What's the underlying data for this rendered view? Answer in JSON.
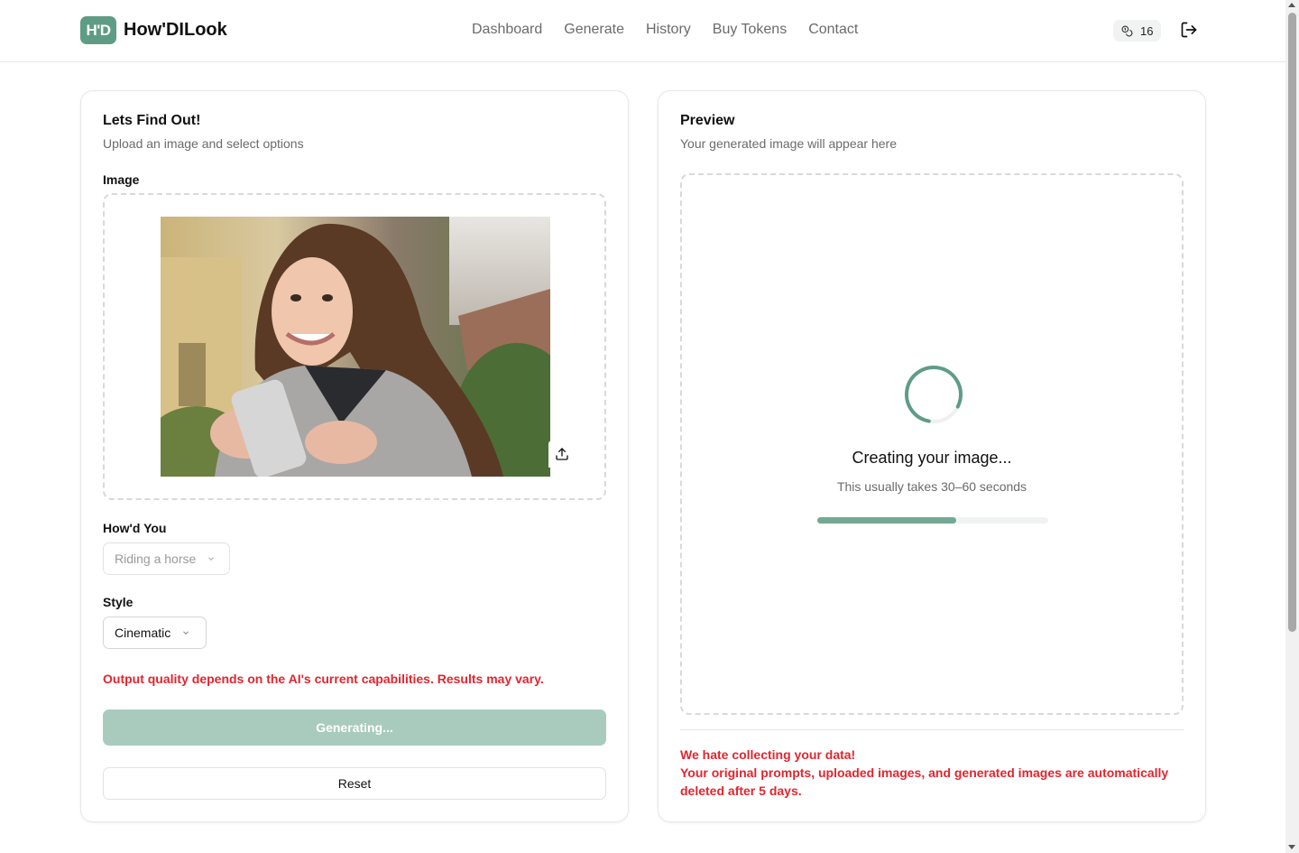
{
  "app": {
    "logo_badge": "H'D",
    "name": "How'DILook"
  },
  "nav": {
    "items": [
      {
        "label": "Dashboard"
      },
      {
        "label": "Generate"
      },
      {
        "label": "History"
      },
      {
        "label": "Buy Tokens"
      },
      {
        "label": "Contact"
      }
    ]
  },
  "tokens": {
    "count": "16",
    "icon": "coins-icon"
  },
  "form": {
    "title": "Lets Find Out!",
    "subtitle": "Upload an image and select options",
    "image_label": "Image",
    "howd_you_label": "How'd You",
    "howd_you_value": "Riding a horse",
    "style_label": "Style",
    "style_value": "Cinematic",
    "warning": "Output quality depends on the AI's current capabilities. Results may vary.",
    "generate_label": "Generating...",
    "reset_label": "Reset"
  },
  "preview": {
    "title": "Preview",
    "subtitle": "Your generated image will appear here",
    "status": "Creating your image...",
    "hint": "This usually takes 30–60 seconds",
    "progress": 0.6,
    "privacy_line1": "We hate collecting your data!",
    "privacy_line2": "Your original prompts, uploaded images, and generated images are automatically deleted after 5 days."
  },
  "colors": {
    "brand": "#5e9c86",
    "button_disabled": "#a9cbbe",
    "warning": "#e0262f",
    "progress": "#73a894"
  }
}
